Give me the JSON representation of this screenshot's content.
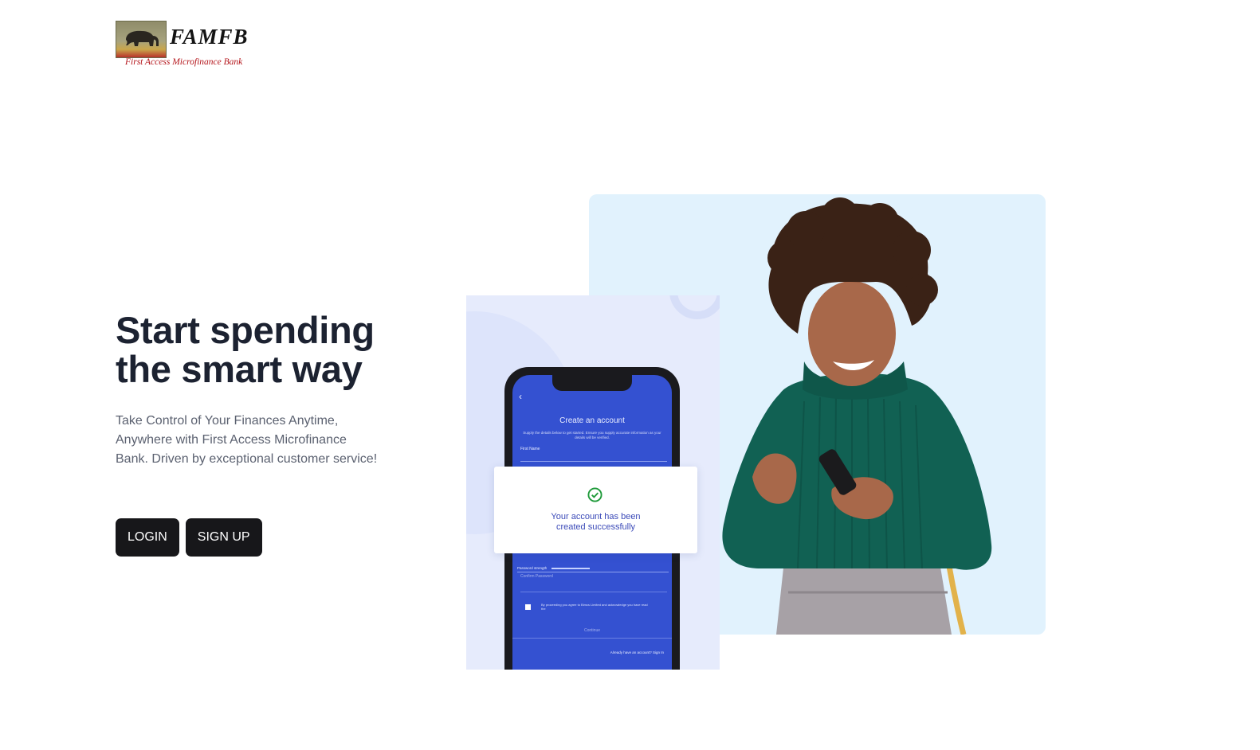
{
  "logo": {
    "wordmark": "FAMFB",
    "tagline": "First Access Microfinance Bank"
  },
  "hero": {
    "title_line1": "Start spending",
    "title_line2": "the smart way",
    "subtitle": "Take Control of Your Finances Anytime, Anywhere with First Access Microfinance Bank. Driven by exceptional customer service!"
  },
  "buttons": {
    "login": "LOGIN",
    "signup": "SIGN UP"
  },
  "phone_screen": {
    "title": "Create an account",
    "description": "Supply the details below to get started. Ensure you supply accurate information as your details will be verified.",
    "first_name_label": "First Name",
    "password_strength_label": "Password strength",
    "confirm_password_placeholder": "Confirm Password",
    "terms_text": "By proceeding you agree to Bimcs Limited and acknowledge you have read the",
    "continue_label": "Continue",
    "signin_text": "Already have an account? Sign In"
  },
  "success_card": {
    "line1": "Your account has been",
    "line2": "created successfully"
  },
  "colors": {
    "primary_button": "#17171a",
    "phone_screen": "#3451d1",
    "illustration_bg": "#e1f2fd",
    "success_check": "#1f9a3a",
    "tagline": "#b4141a"
  },
  "icons": [
    "elephant-icon",
    "back-chevron-icon",
    "check-circle-icon"
  ]
}
